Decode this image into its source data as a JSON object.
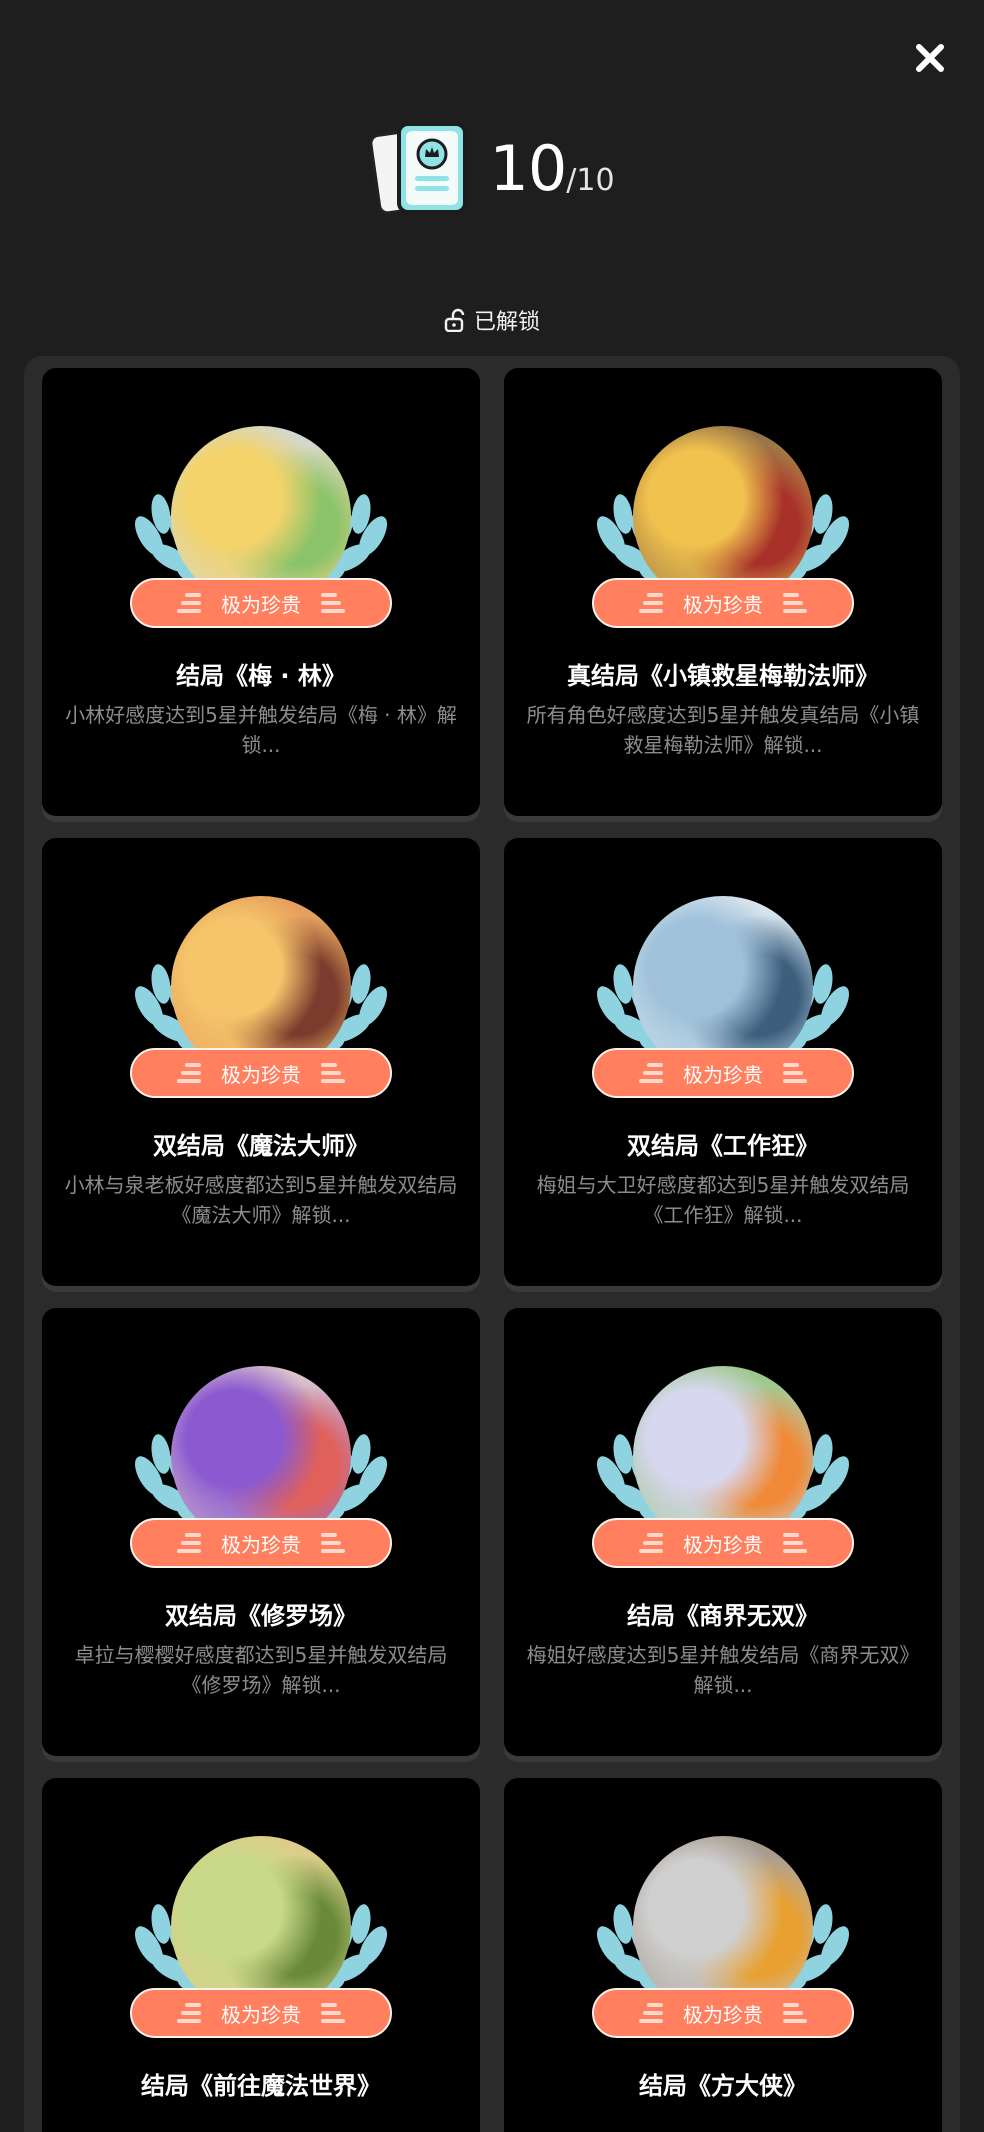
{
  "header": {
    "unlocked_count": "10",
    "separator": "/",
    "total_count": "10",
    "unlocked_label": "已解锁"
  },
  "badge_label": "极为珍贵",
  "colors": {
    "badge": "#ff7f5f",
    "laurel": "#8fd3e0",
    "background": "#1e1e1e",
    "card": "#000000"
  },
  "cards": [
    {
      "title": "结局《梅 · 林》",
      "desc": "小林好感度达到5星并触发结局《梅 · 林》解锁...",
      "art": [
        "#f4d36a",
        "#8bc36a",
        "#c7d9ef"
      ]
    },
    {
      "title": "真结局《小镇救星梅勒法师》",
      "desc": "所有角色好感度达到5星并触发真结局《小镇救星梅勒法师》解锁...",
      "art": [
        "#f1c24e",
        "#a8322a",
        "#7a5a44"
      ]
    },
    {
      "title": "双结局《魔法大师》",
      "desc": "小林与泉老板好感度都达到5星并触发双结局《魔法大师》解锁...",
      "art": [
        "#f6c56a",
        "#7c3b2d",
        "#e0925a"
      ]
    },
    {
      "title": "双结局《工作狂》",
      "desc": "梅姐与大卫好感度都达到5星并触发双结局《工作狂》解锁...",
      "art": [
        "#9fc2da",
        "#3d5f7d",
        "#e8eef3"
      ]
    },
    {
      "title": "双结局《修罗场》",
      "desc": "卓拉与樱樱好感度都达到5星并触发双结局《修罗场》解锁...",
      "art": [
        "#8b5ad0",
        "#e0605a",
        "#f3e3c8"
      ]
    },
    {
      "title": "结局《商界无双》",
      "desc": "梅姐好感度达到5星并触发结局《商界无双》解锁...",
      "art": [
        "#d7d7ef",
        "#f08a38",
        "#8bc36a"
      ]
    },
    {
      "title": "结局《前往魔法世界》",
      "desc": "",
      "art": [
        "#c8d98a",
        "#6a8a3a",
        "#e6c88a"
      ]
    },
    {
      "title": "结局《方大侠》",
      "desc": "",
      "art": [
        "#cfcfcf",
        "#e8a030",
        "#9a8a7a"
      ]
    }
  ]
}
